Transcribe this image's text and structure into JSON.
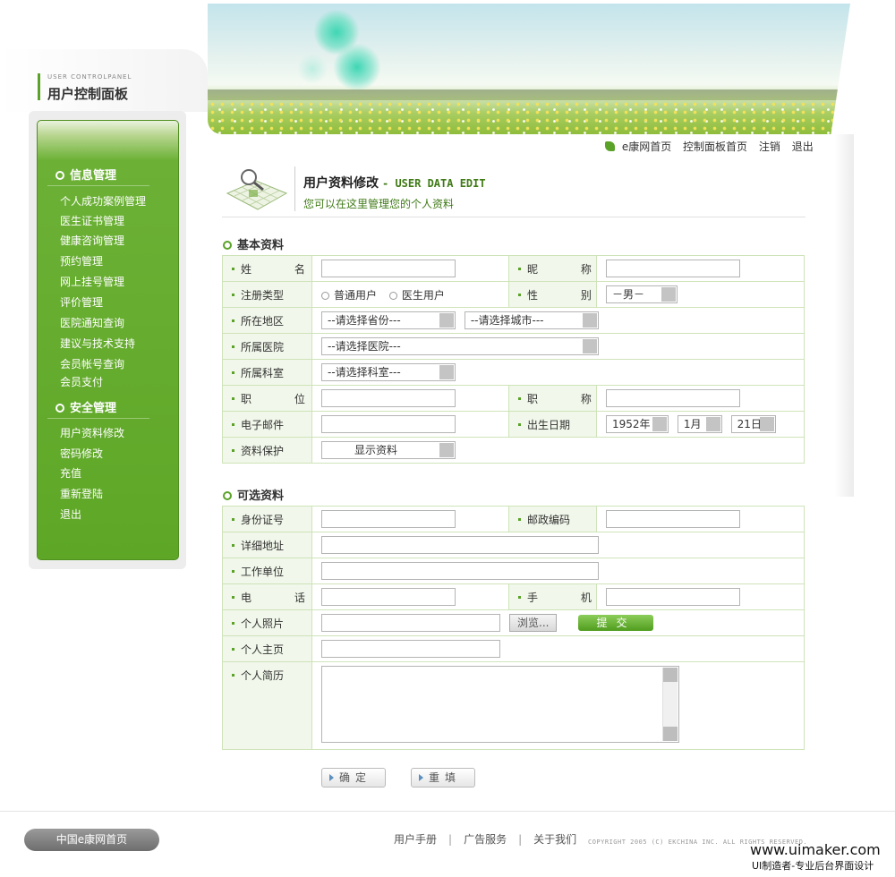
{
  "header": {
    "panel_sub": "USER CONTROLPANEL",
    "panel_title": "用户控制面板",
    "top_links": [
      "e康网首页",
      "控制面板首页",
      "注销",
      "退出"
    ]
  },
  "sidebar": {
    "section1": "信息管理",
    "items1": [
      "个人成功案例管理",
      "医生证书管理",
      "健康咨询管理",
      "预约管理",
      "网上挂号管理",
      "评价管理",
      "医院通知查询",
      "建议与技术支持",
      "会员帐号查询",
      "会员支付"
    ],
    "section2": "安全管理",
    "items2": [
      "用户资料修改",
      "密码修改",
      "充值",
      "重新登陆",
      "退出"
    ]
  },
  "page": {
    "title": "用户资料修改",
    "title_en": "- USER DATA EDIT",
    "desc": "您可以在这里管理您的个人资料"
  },
  "basic": {
    "title": "基本资料",
    "name": "姓 名",
    "nickname": "昵 称",
    "reg_type": "注册类型",
    "reg_opt1": "普通用户",
    "reg_opt2": "医生用户",
    "gender": "性 别",
    "gender_val": "－男－",
    "region": "所在地区",
    "province": "--请选择省份---",
    "city": "--请选择城市---",
    "hospital": "所属医院",
    "hospital_val": "--请选择医院---",
    "dept": "所属科室",
    "dept_val": "--请选择科室---",
    "position": "职 位",
    "title_lbl": "职 称",
    "email": "电子邮件",
    "birth": "出生日期",
    "year": "1952年",
    "month": "1月",
    "day": "21日",
    "protect": "资料保护",
    "protect_val": "显示资料"
  },
  "optional": {
    "title": "可选资料",
    "id_no": "身份证号",
    "zip": "邮政编码",
    "address": "详细地址",
    "work": "工作单位",
    "phone": "电 话",
    "mobile": "手 机",
    "photo": "个人照片",
    "browse": "浏览...",
    "submit": "提交",
    "homepage": "个人主页",
    "resume": "个人简历"
  },
  "actions": {
    "confirm": "确定",
    "reset": "重填"
  },
  "footer": {
    "home": "中国e康网首页",
    "links": [
      "用户手册",
      "广告服务",
      "关于我们"
    ],
    "copyright": "COPYRIGHT 2005 (C) EKCHINA INC. ALL RIGHTS RESERVED.",
    "wm1": "www.uimaker.com",
    "wm2": "UI制造者-专业后台界面设计"
  },
  "colors": {
    "accent": "#5aa228",
    "label_bg": "#f1f7ea",
    "border": "#cfe3b9"
  }
}
